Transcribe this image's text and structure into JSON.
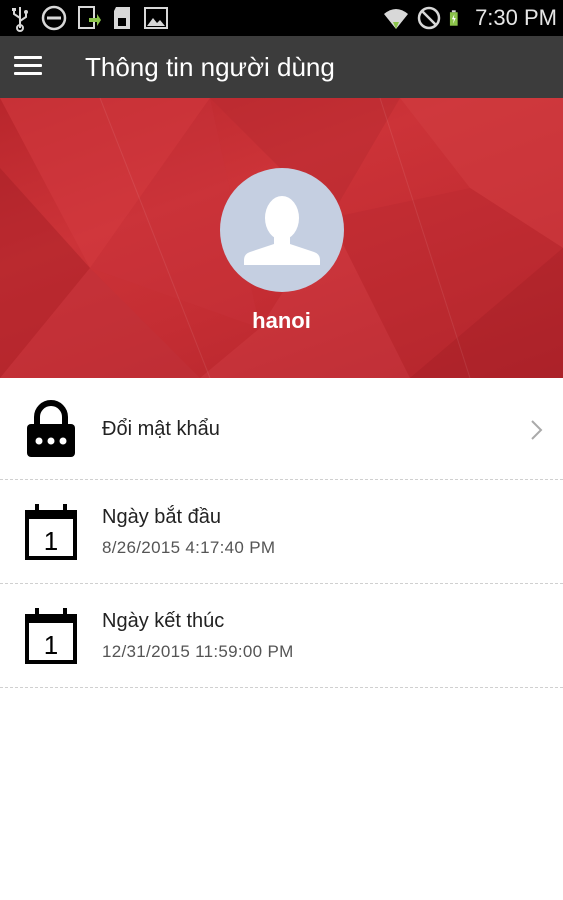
{
  "status_bar": {
    "time": "7:30 PM",
    "left_icons": [
      "usb-icon",
      "do-not-disturb-icon",
      "download-icon",
      "sd-card-icon",
      "image-icon"
    ],
    "right_icons": [
      "wifi-icon",
      "no-signal-icon",
      "battery-charging-icon"
    ]
  },
  "action_bar": {
    "menu_icon": "hamburger-menu-icon",
    "title": "Thông tin người dùng"
  },
  "profile": {
    "avatar_icon": "user-silhouette-icon",
    "username": "hanoi"
  },
  "items": [
    {
      "icon": "lock-icon",
      "title": "Đổi mật khẩu",
      "chevron_icon": "chevron-right-icon"
    },
    {
      "icon": "calendar-icon",
      "calendar_day": "1",
      "title": "Ngày bắt đầu",
      "value": "8/26/2015 4:17:40 PM"
    },
    {
      "icon": "calendar-icon",
      "calendar_day": "1",
      "title": "Ngày kết thúc",
      "value": "12/31/2015 11:59:00 PM"
    }
  ],
  "colors": {
    "status_bar": "#000000",
    "action_bar": "#3c3c3c",
    "header_red": "#c42d33",
    "avatar_bg": "#c5cfe1"
  }
}
